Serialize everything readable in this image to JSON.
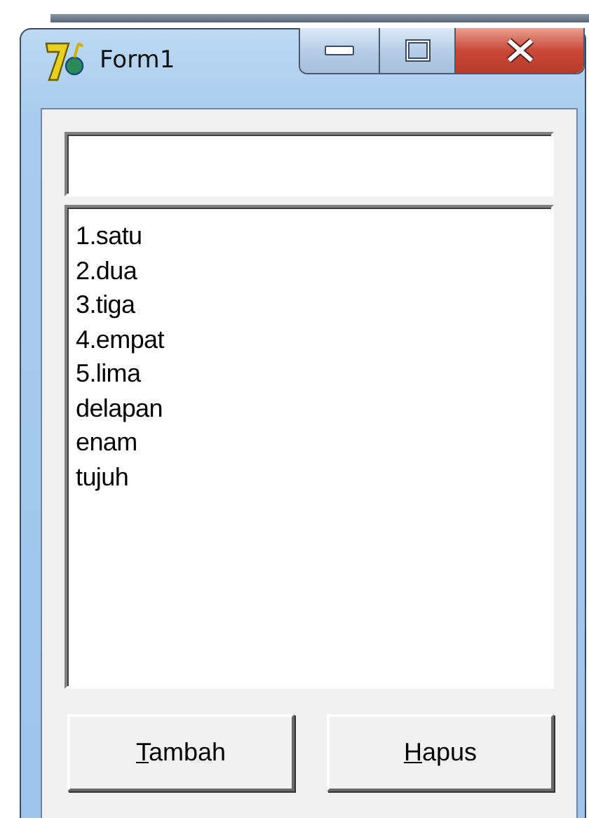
{
  "window": {
    "title": "Form1"
  },
  "list_box": {
    "items": [
      "1.satu",
      "2.dua",
      "3.tiga",
      "4.empat",
      "5.lima",
      "delapan",
      "enam",
      "tujuh"
    ]
  },
  "buttons": [
    {
      "label": "Tambah",
      "first_letter_underlined": true
    },
    {
      "label": "Hapus",
      "first_letter_underlined": true
    }
  ]
}
